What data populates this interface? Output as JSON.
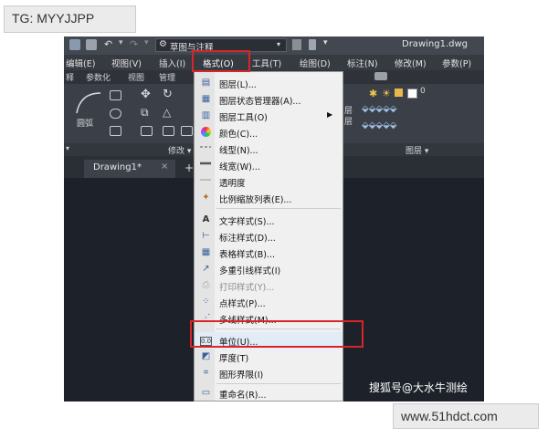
{
  "tag": "TG: MYYJJPP",
  "site": "www.51hdct.com",
  "watermark": "搜狐号@大水牛测绘",
  "title_bar": {
    "workspace": "草图与注释",
    "file_name": "Drawing1.dwg"
  },
  "menubar": {
    "items": [
      "编辑(E)",
      "视图(V)",
      "插入(I)",
      "格式(O)",
      "工具(T)",
      "绘图(D)",
      "标注(N)",
      "修改(M)",
      "参数(P)"
    ]
  },
  "ribbon_tabs": [
    "释",
    "参数化",
    "视图",
    "管理"
  ],
  "ribbon": {
    "arc_label": "圆弧",
    "modify_label": "修改 ▾",
    "layer_label": "图层 ▾",
    "layer_number": "0",
    "layer_side_label": "层"
  },
  "doc_tab": {
    "label": "Drawing1*",
    "close": "×",
    "add": "+"
  },
  "format_menu": {
    "items": [
      {
        "label": "图层(L)...",
        "icon": "layers-icon"
      },
      {
        "label": "图层状态管理器(A)...",
        "icon": "layer-states-icon"
      },
      {
        "label": "图层工具(O)",
        "icon": "layer-tools-icon",
        "submenu": true
      },
      {
        "label": "颜色(C)...",
        "icon": "color-wheel-icon"
      },
      {
        "label": "线型(N)...",
        "icon": "linetype-icon"
      },
      {
        "label": "线宽(W)...",
        "icon": "lineweight-icon"
      },
      {
        "label": "透明度",
        "icon": "transparency-icon"
      },
      {
        "label": "比例缩放列表(E)...",
        "icon": "scale-list-icon"
      },
      {
        "label": "文字样式(S)...",
        "icon": "text-style-icon"
      },
      {
        "label": "标注样式(D)...",
        "icon": "dim-style-icon"
      },
      {
        "label": "表格样式(B)...",
        "icon": "table-style-icon"
      },
      {
        "label": "多重引线样式(I)",
        "icon": "multileader-style-icon"
      },
      {
        "label": "打印样式(Y)...",
        "icon": "plot-style-icon",
        "disabled": true
      },
      {
        "label": "点样式(P)...",
        "icon": "point-style-icon"
      },
      {
        "label": "多线样式(M)...",
        "icon": "mline-style-icon"
      },
      {
        "label": "单位(U)...",
        "icon": "units-icon"
      },
      {
        "label": "厚度(T)",
        "icon": "thickness-icon"
      },
      {
        "label": "图形界限(I)",
        "icon": "drawing-limits-icon"
      },
      {
        "label": "重命名(R)...",
        "icon": "rename-icon"
      }
    ]
  },
  "colors": {
    "highlight": "#d9252a",
    "menu_bg": "#f0f0f0",
    "canvas": "#1c212a"
  }
}
